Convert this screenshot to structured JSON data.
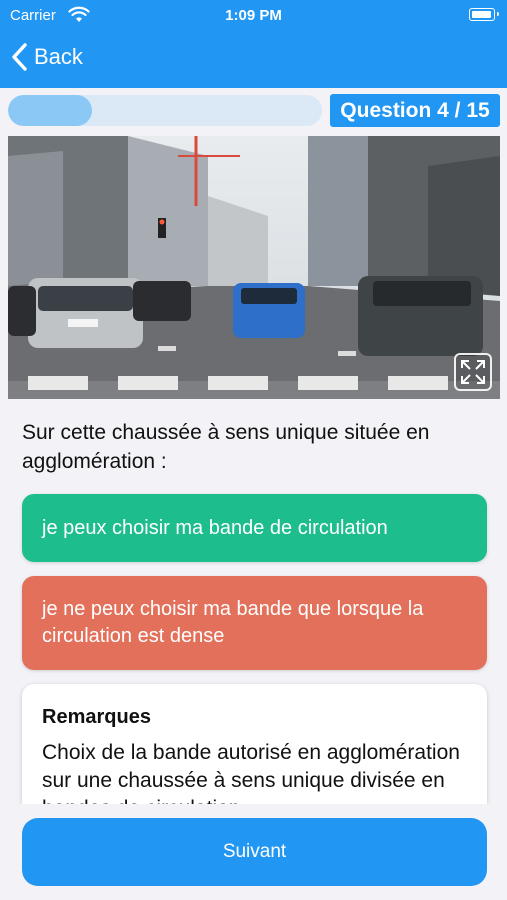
{
  "status_bar": {
    "carrier": "Carrier",
    "time": "1:09 PM"
  },
  "nav": {
    "back_label": "Back"
  },
  "quiz": {
    "progress": 0.267,
    "counter": "Question 4 / 15",
    "photo_icon": "expand-icon",
    "question": "Sur cette chaussée à sens unique située en agglomération :",
    "answers": [
      {
        "text": "je peux choisir ma bande de circulation",
        "status": "correct",
        "color": "#1dbd8e"
      },
      {
        "text": "je ne peux choisir ma bande que lorsque la circulation est dense",
        "status": "incorrect",
        "color": "#e3705a"
      }
    ],
    "remarks": {
      "title": "Remarques",
      "body": "Choix de la bande autorisé en agglomération sur une chaussée à sens unique divisée en bandes de circulation"
    }
  },
  "footer": {
    "next_label": "Suivant"
  },
  "colors": {
    "accent": "#2196f3",
    "correct": "#1dbd8e",
    "incorrect": "#e3705a"
  }
}
